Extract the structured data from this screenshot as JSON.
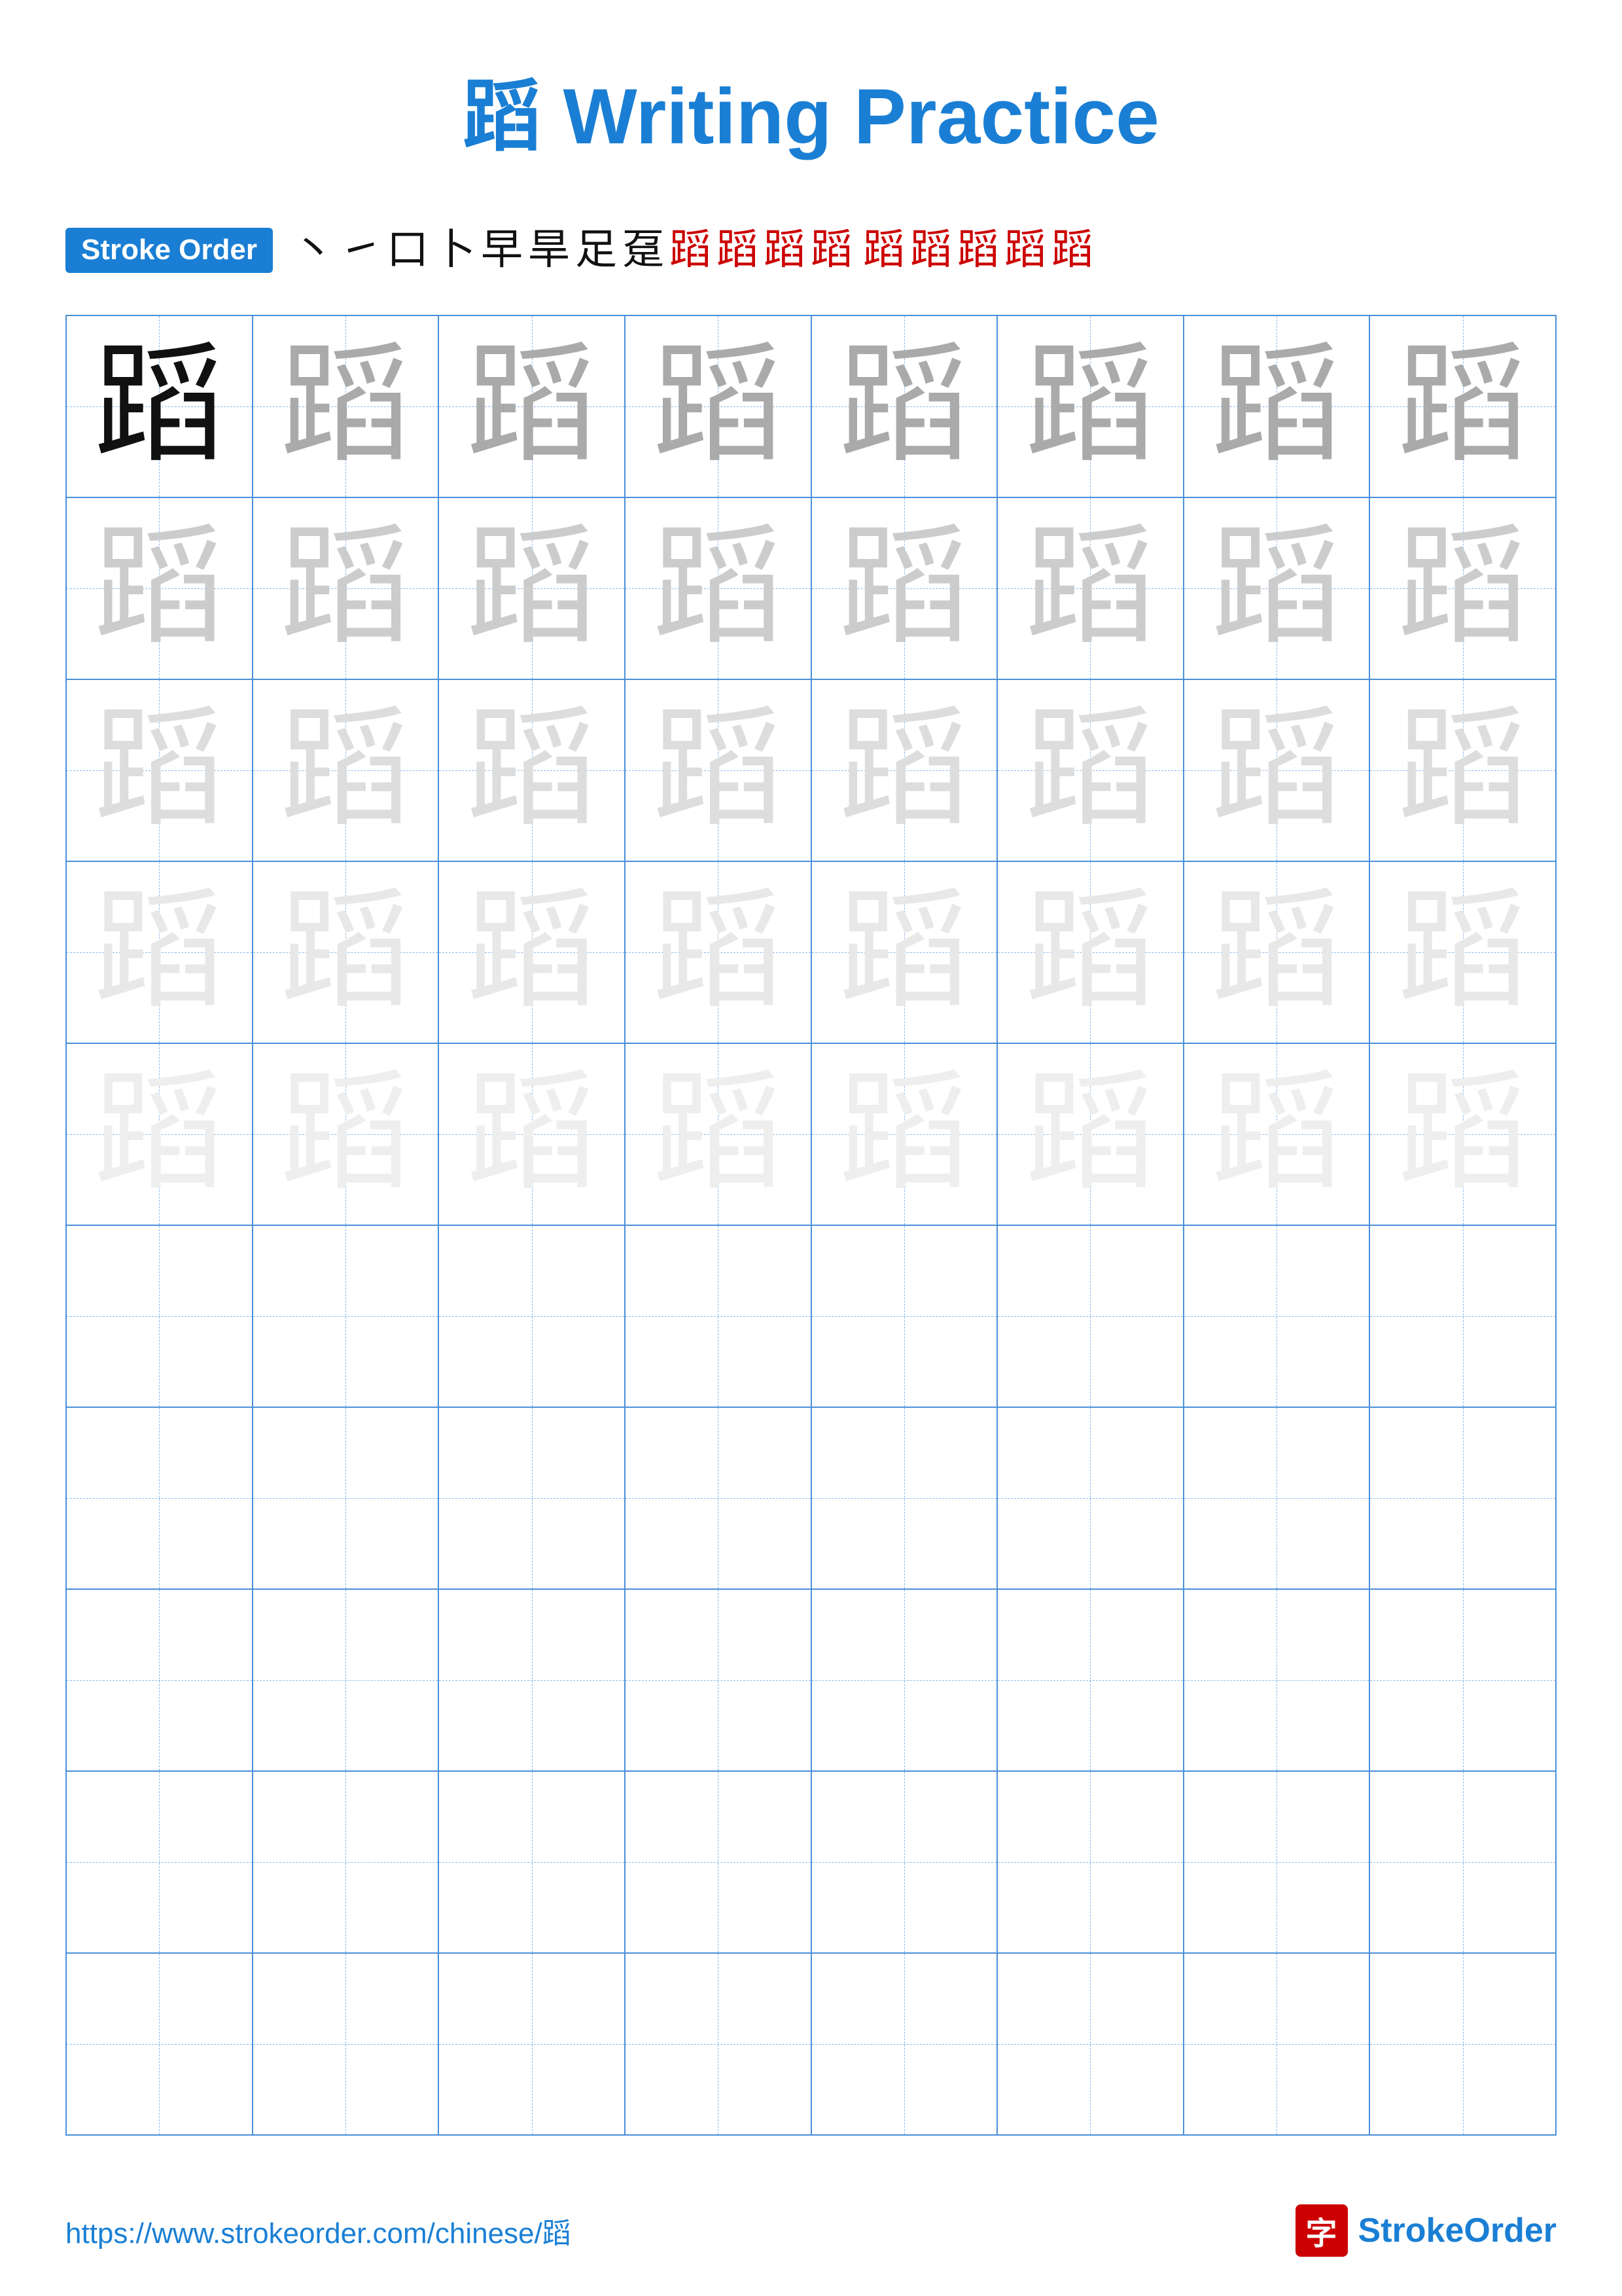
{
  "title": {
    "char": "蹈",
    "label": "Writing Practice",
    "full": "蹈 Writing Practice"
  },
  "stroke_order": {
    "badge_label": "Stroke Order",
    "chars": [
      "丨",
      "㇀",
      "口",
      "𠂉",
      "早",
      "早",
      "足",
      "足",
      "蹈",
      "蹈",
      "蹈",
      "蹈",
      "蹈",
      "蹈",
      "蹈",
      "蹈",
      "蹈"
    ]
  },
  "practice_char": "蹈",
  "grid": {
    "rows": 10,
    "cols": 8
  },
  "footer": {
    "url": "https://www.strokeorder.com/chinese/蹈",
    "logo_char": "字",
    "logo_text": "StrokeOrder"
  },
  "colors": {
    "blue": "#1a7fd4",
    "red": "#cc0000",
    "dark": "#111111",
    "medium": "#aaaaaa",
    "light": "#cccccc",
    "lighter": "#dddddd",
    "faint": "#e8e8e8"
  }
}
